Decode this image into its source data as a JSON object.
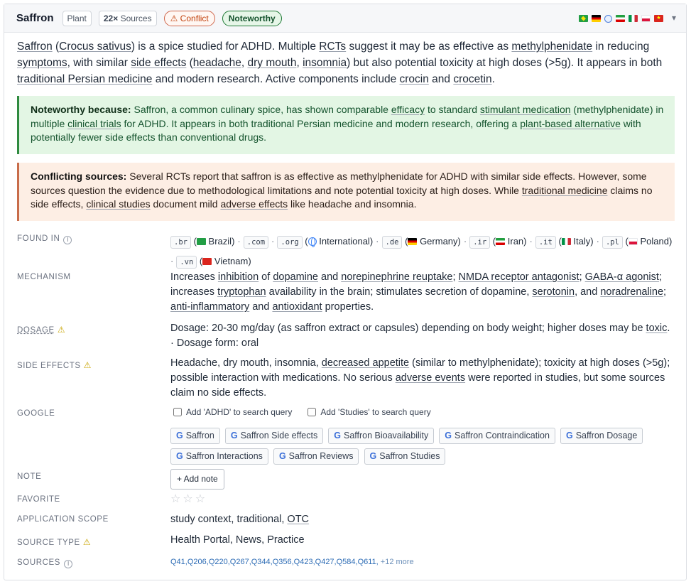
{
  "header": {
    "title": "Saffron",
    "type_chip": "Plant",
    "sources_count": "22×",
    "sources_word": "Sources",
    "conflict_label": "⚠ Conflict",
    "noteworthy_label": "Noteworthy",
    "flags": [
      "brazil-flag",
      "germany-flag",
      "globe-icon",
      "iran-flag",
      "italy-flag",
      "poland-flag",
      "vietnam-flag"
    ],
    "caret": "▾"
  },
  "summary": {
    "p1": "Saffron",
    "p2": " (",
    "p3": "Crocus sativus",
    "p4": ") is a spice studied for ADHD. Multiple ",
    "p5": "RCTs",
    "p6": " suggest it may be as effective as ",
    "p7": "methylphenidate",
    "p8": " in reducing ",
    "p9": "symptoms",
    "p10": ", with similar ",
    "p11": "side effects",
    "p12": " (",
    "p13": "headache",
    "p14": ", ",
    "p15": "dry mouth",
    "p16": ", ",
    "p17": "insomnia",
    "p18": ") but also potential toxicity at high doses (>5g). It appears in both ",
    "p19": "traditional Persian medicine",
    "p20": " and modern research. Active components include ",
    "p21": "crocin",
    "p22": " and ",
    "p23": "crocetin",
    "p24": "."
  },
  "noteworthy": {
    "heading": "Noteworthy because:",
    "t1": " Saffron, a common culinary spice, has shown comparable ",
    "u1": "efficacy",
    "t2": " to standard ",
    "u2": "stimulant medication",
    "t3": " (methylphenidate) in multiple ",
    "u3": "clinical trials",
    "t4": " for ADHD. It appears in both traditional Persian medicine and modern research, offering a ",
    "u4": "plant-based alternative",
    "t5": " with potentially fewer side effects than conventional drugs."
  },
  "conflict": {
    "heading": "Conflicting sources:",
    "t1": " Several RCTs report that saffron is as effective as methylphenidate for ADHD with similar side effects. However, some sources question the evidence due to methodological limitations and note potential toxicity at high doses. While ",
    "u1": "traditional medicine",
    "t2": " claims no side effects, ",
    "u2": "clinical studies",
    "t3": " document mild ",
    "u3": "adverse effects",
    "t4": " like headache and insomnia."
  },
  "found_in": {
    "label": "Found in",
    "entries": [
      {
        "tld": ".br",
        "country": "Brazil"
      },
      {
        "tld": ".com",
        "country": ""
      },
      {
        "tld": ".org",
        "country": "International"
      },
      {
        "tld": ".de",
        "country": "Germany"
      },
      {
        "tld": ".ir",
        "country": "Iran"
      },
      {
        "tld": ".it",
        "country": "Italy"
      },
      {
        "tld": ".pl",
        "country": "Poland"
      },
      {
        "tld": ".vn",
        "country": "Vietnam"
      }
    ]
  },
  "mechanism": {
    "label": "Mechanism",
    "t1": "Increases ",
    "u1": "inhibition",
    "t2": " of ",
    "u2": "dopamine",
    "t3": " and ",
    "u3": "norepinephrine reuptake",
    "t4": "; ",
    "u4": "NMDA receptor antagonist",
    "t5": "; ",
    "u5": "GABA-α agonist",
    "t6": "; increases ",
    "u6": "tryptophan",
    "t7": " availability in the brain; stimulates secretion of dopamine, ",
    "u7": "serotonin",
    "t8": ", and ",
    "u8": "noradrenaline",
    "t9": "; ",
    "u9": "anti-inflammatory",
    "t10": " and ",
    "u10": "antioxidant",
    "t11": " properties."
  },
  "dosage": {
    "label": "Dosage",
    "t1": "Dosage: 20-30 mg/day (as saffron extract or capsules) depending on body weight; higher doses may be ",
    "u1": "toxic",
    "t2": ".",
    "t3": "· Dosage form: oral"
  },
  "side_effects": {
    "label": "Side effects",
    "t1": "Headache, dry mouth, insomnia, ",
    "u1": "decreased appetite",
    "t2": " (similar to methylphenidate); toxicity at high doses (>5g); possible interaction with medications. No serious ",
    "u2": "adverse events",
    "t3": " were reported in studies, but some sources claim no side effects."
  },
  "google": {
    "label": "Google",
    "check1": "Add 'ADHD' to search query",
    "check2": "Add 'Studies' to search query",
    "buttons": [
      "Saffron",
      "Saffron Side effects",
      "Saffron Bioavailability",
      "Saffron Contraindication",
      "Saffron Dosage",
      "Saffron Interactions",
      "Saffron Reviews",
      "Saffron Studies"
    ]
  },
  "note": {
    "label": "Note",
    "button": "+ Add note"
  },
  "favorite": {
    "label": "Favorite",
    "stars": "☆☆☆"
  },
  "application_scope": {
    "label": "Application scope",
    "t1": "study context, traditional, ",
    "u1": "OTC"
  },
  "source_type": {
    "label": "Source type",
    "value": "Health Portal, News, Practice"
  },
  "sources": {
    "label": "Sources",
    "list": "Q41,Q206,Q220,Q267,Q344,Q356,Q423,Q427,Q584,Q611,",
    "more": " +12 more"
  }
}
